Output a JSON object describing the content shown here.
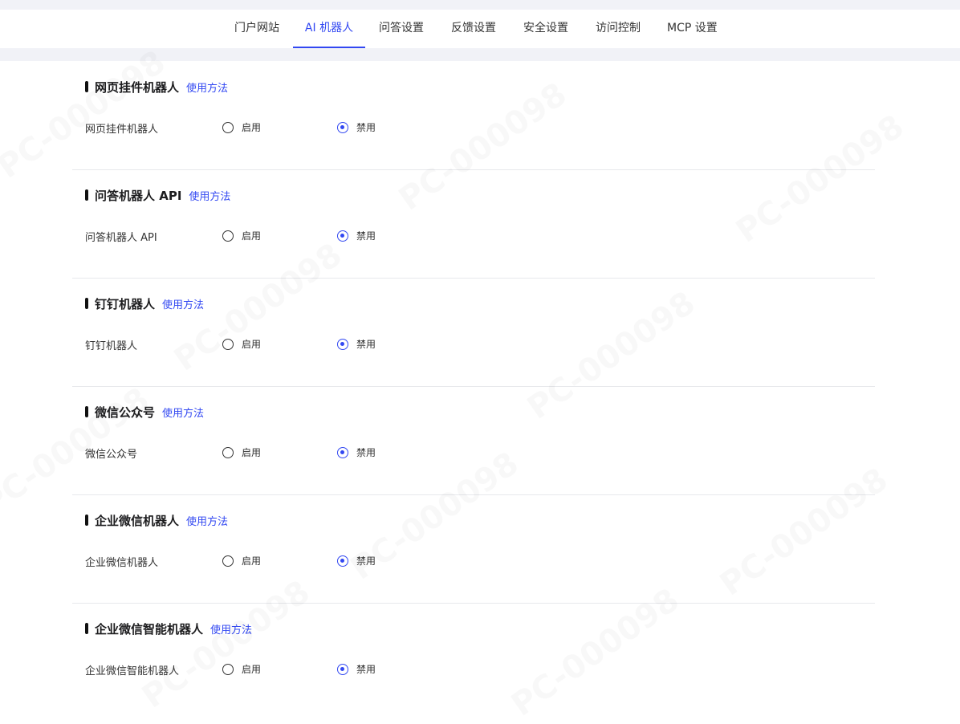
{
  "tabs": [
    {
      "label": "门户网站",
      "active": false
    },
    {
      "label": "AI 机器人",
      "active": true
    },
    {
      "label": "问答设置",
      "active": false
    },
    {
      "label": "反馈设置",
      "active": false
    },
    {
      "label": "安全设置",
      "active": false
    },
    {
      "label": "访问控制",
      "active": false
    },
    {
      "label": "MCP 设置",
      "active": false
    }
  ],
  "accent_color": "#3248f2",
  "watermark": "PC-000098",
  "sections": [
    {
      "title": "网页挂件机器人",
      "link": "使用方法",
      "row_label": "网页挂件机器人",
      "enable": "启用",
      "disable": "禁用",
      "value": "disable"
    },
    {
      "title": "问答机器人 API",
      "link": "使用方法",
      "row_label": "问答机器人 API",
      "enable": "启用",
      "disable": "禁用",
      "value": "disable"
    },
    {
      "title": "钉钉机器人",
      "link": "使用方法",
      "row_label": "钉钉机器人",
      "enable": "启用",
      "disable": "禁用",
      "value": "disable"
    },
    {
      "title": "微信公众号",
      "link": "使用方法",
      "row_label": "微信公众号",
      "enable": "启用",
      "disable": "禁用",
      "value": "disable"
    },
    {
      "title": "企业微信机器人",
      "link": "使用方法",
      "row_label": "企业微信机器人",
      "enable": "启用",
      "disable": "禁用",
      "value": "disable"
    },
    {
      "title": "企业微信智能机器人",
      "link": "使用方法",
      "row_label": "企业微信智能机器人",
      "enable": "启用",
      "disable": "禁用",
      "value": "disable"
    }
  ]
}
